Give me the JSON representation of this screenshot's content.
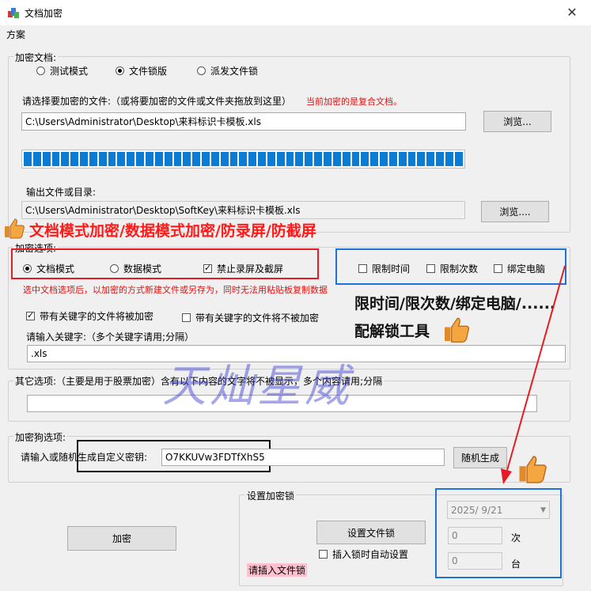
{
  "window": {
    "title": "文档加密",
    "close_glyph": "✕"
  },
  "menu": {
    "items": [
      "方案"
    ]
  },
  "encrypt_docs": {
    "group_title": "加密文档:",
    "modes": [
      {
        "label": "测试模式",
        "selected": false
      },
      {
        "label": "文件锁版",
        "selected": true
      },
      {
        "label": "派发文件锁",
        "selected": false
      }
    ],
    "select_prompt": "请选择要加密的文件:（或将要加密的文件或文件夹拖放到这里）",
    "notice": "当前加密的是复合文档。",
    "input_path": "C:\\Users\\Administrator\\Desktop\\来料标识卡模板.xls",
    "browse1": "浏览...",
    "progress": 1.0,
    "output_label": "输出文件或目录:",
    "output_path": "C:\\Users\\Administrator\\Desktop\\SoftKey\\来料标识卡模板.xls",
    "browse2": "浏览...."
  },
  "promo": {
    "headline": "文档模式加密/数据模式加密/防录屏/防截屏",
    "side_line1": "限时间/限次数/绑定电脑/......",
    "side_line2": "配解锁工具",
    "watermark": "天灿星威"
  },
  "encrypt_options": {
    "group_title": "加密选项:",
    "modes": [
      {
        "label": "文档模式",
        "selected": true
      },
      {
        "label": "数据模式",
        "selected": false
      }
    ],
    "no_screen": {
      "label": "禁止录屏及截屏",
      "checked": true
    },
    "limits": [
      {
        "label": "限制时间",
        "checked": false
      },
      {
        "label": "限制次数",
        "checked": false
      },
      {
        "label": "绑定电脑",
        "checked": false
      }
    ],
    "notice": "选中文档选项后，以加密的方式新建文件或另存为，同时无法用粘贴板复制数据",
    "kw_encrypt": {
      "label": "带有关键字的文件将被加密",
      "checked": true
    },
    "kw_skip": {
      "label": "带有关键字的文件将不被加密",
      "checked": false
    },
    "kw_prompt": "请输入关键字:（多个关键字请用;分隔）",
    "kw_value": ".xls"
  },
  "other_options": {
    "group_title": "其它选项:（主要是用于股票加密）含有以下内容的文字将不被显示，多个内容请用;分隔",
    "value": ""
  },
  "dongle_options": {
    "group_title": "加密狗选项:",
    "key_prompt": "请输入或随机生成自定义密钥:",
    "key_value": "O7KKUVw3FDTfXhS5",
    "random_button": "随机生成"
  },
  "lock_settings": {
    "group_title": "设置加密锁",
    "set_button": "设置文件锁",
    "auto_set": {
      "label": "插入锁时自动设置",
      "checked": false
    },
    "status": "请插入文件锁",
    "date_value": "2025/  9/21",
    "count_value": "0",
    "count_unit": "次",
    "machines_value": "0",
    "machines_unit": "台"
  },
  "encrypt_button": "加密",
  "colors": {
    "highlight_red": "#e51c23",
    "highlight_blue": "#1e73d8",
    "progress_blue": "#0a7cd6",
    "status_bg": "#ffc0d0"
  }
}
